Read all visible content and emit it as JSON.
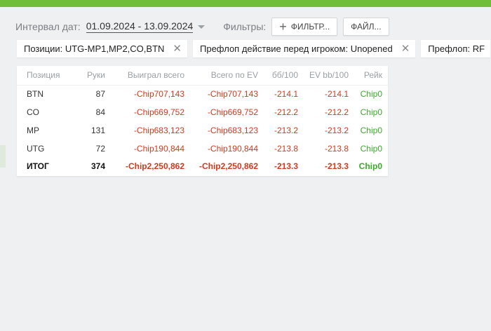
{
  "toolbar": {
    "date_interval_label": "Интервал дат:",
    "date_range": "01.09.2024 - 13.09.2024",
    "filters_label": "Фильтры:",
    "filter_button_label": "ФИЛЬТР...",
    "file_button_label": "ФАЙЛ..."
  },
  "chips": [
    {
      "label": "Позиции: UTG-MP1,MP2,CO,BTN"
    },
    {
      "label": "Префлоп действие перед игроком: Unopened"
    },
    {
      "label": "Префлоп: RF"
    }
  ],
  "table": {
    "headers": [
      "Позиция",
      "Руки",
      "Выиграл всего",
      "Всего по EV",
      "бб/100",
      "EV bb/100",
      "Рейк"
    ],
    "rows": [
      {
        "position": "BTN",
        "hands": "87",
        "won": "-Chip707,143",
        "ev": "-Chip707,143",
        "bb100": "-214.1",
        "evbb100": "-214.1",
        "rake": "Chip0"
      },
      {
        "position": "CO",
        "hands": "84",
        "won": "-Chip669,752",
        "ev": "-Chip669,752",
        "bb100": "-212.2",
        "evbb100": "-212.2",
        "rake": "Chip0"
      },
      {
        "position": "MP",
        "hands": "131",
        "won": "-Chip683,123",
        "ev": "-Chip683,123",
        "bb100": "-213.2",
        "evbb100": "-213.2",
        "rake": "Chip0"
      },
      {
        "position": "UTG",
        "hands": "72",
        "won": "-Chip190,844",
        "ev": "-Chip190,844",
        "bb100": "-213.8",
        "evbb100": "-213.8",
        "rake": "Chip0"
      }
    ],
    "total": {
      "position": "ИТОГ",
      "hands": "374",
      "won": "-Chip2,250,862",
      "ev": "-Chip2,250,862",
      "bb100": "-213.3",
      "evbb100": "-213.3",
      "rake": "Chip0"
    }
  },
  "icons": {
    "plus": "plus-icon",
    "close": "close-icon",
    "caret": "caret-down-icon"
  },
  "colors": {
    "accent": "#6fbe3a",
    "negative": "#d13a1e",
    "positive": "#3aab2a"
  }
}
